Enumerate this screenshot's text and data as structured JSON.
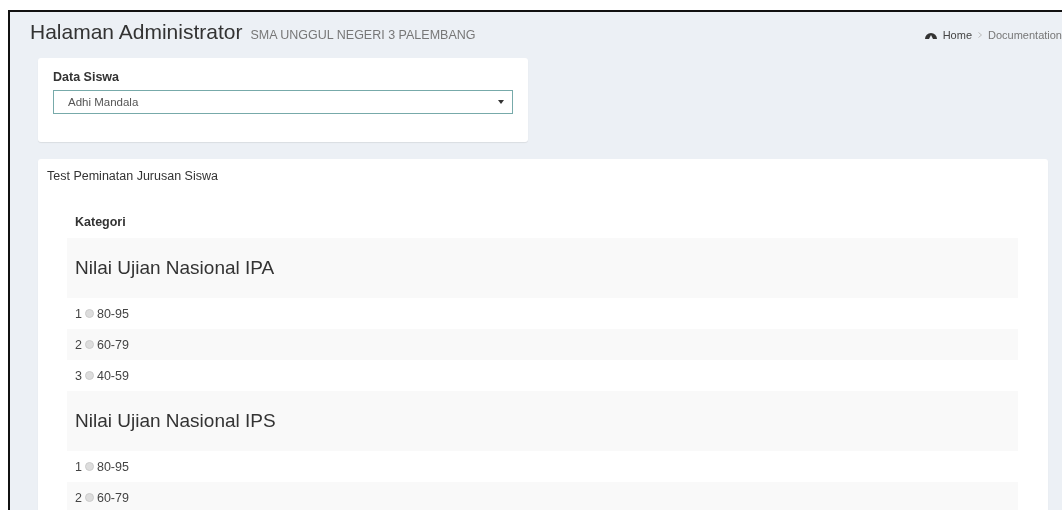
{
  "header": {
    "title": "Halaman Administrator",
    "subtitle": "SMA UNGGUL NEGERI 3 PALEMBANG"
  },
  "breadcrumb": [
    "Home",
    "Documentation"
  ],
  "student_select": {
    "label": "Data Siswa",
    "value": "Adhi Mandala"
  },
  "test": {
    "title": "Test Peminatan Jurusan Siswa",
    "column": "Kategori",
    "groups": [
      {
        "title": "Nilai Ujian Nasional IPA",
        "options": [
          {
            "number": "1",
            "label": "80-95",
            "selected": false
          },
          {
            "number": "2",
            "label": "60-79",
            "selected": false
          },
          {
            "number": "3",
            "label": "40-59",
            "selected": false
          }
        ]
      },
      {
        "title": "Nilai Ujian Nasional IPS",
        "options": [
          {
            "number": "1",
            "label": "80-95",
            "selected": false
          },
          {
            "number": "2",
            "label": "60-79",
            "selected": false
          }
        ]
      }
    ]
  }
}
